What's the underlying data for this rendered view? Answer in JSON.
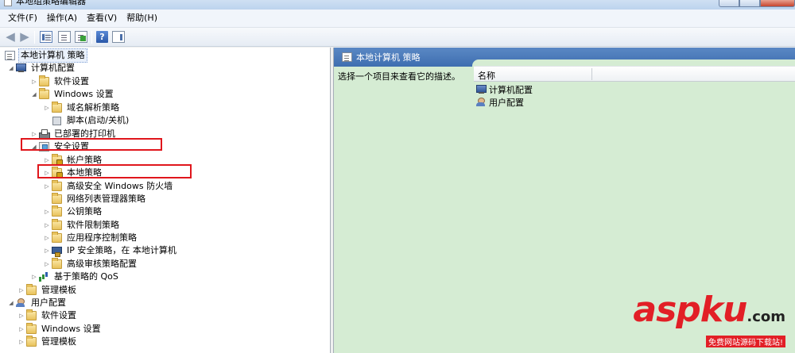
{
  "window": {
    "title": "本地组策略编辑器"
  },
  "menu": [
    {
      "label": "文件(F)"
    },
    {
      "label": "操作(A)"
    },
    {
      "label": "查看(V)"
    },
    {
      "label": "帮助(H)"
    }
  ],
  "toolbar": {
    "back_icon": "back-arrow-icon",
    "forward_icon": "forward-arrow-icon",
    "help_glyph": "?"
  },
  "tree": {
    "root": "本地计算机 策略",
    "computer_config": "计算机配置",
    "software_settings": "软件设置",
    "windows_settings": "Windows 设置",
    "dns_policy": "域名解析策略",
    "scripts": "脚本(启动/关机)",
    "deployed_printers": "已部署的打印机",
    "security_settings": "安全设置",
    "account_policies": "帐户策略",
    "local_policies": "本地策略",
    "firewall": "高级安全 Windows 防火墙",
    "network_list": "网络列表管理器策略",
    "public_key": "公钥策略",
    "software_restriction": "软件限制策略",
    "app_control": "应用程序控制策略",
    "ipsec": "IP 安全策略，在 本地计算机",
    "audit_config": "高级审核策略配置",
    "qos": "基于策略的 QoS",
    "admin_templates": "管理模板",
    "user_config": "用户配置",
    "user_software_settings": "软件设置",
    "user_windows_settings": "Windows 设置",
    "user_admin_templates": "管理模板"
  },
  "right_pane": {
    "header": "本地计算机 策略",
    "description": "选择一个项目来查看它的描述。",
    "column_name": "名称",
    "items": [
      {
        "label": "计算机配置",
        "icon": "computer-icon"
      },
      {
        "label": "用户配置",
        "icon": "user-icon"
      }
    ]
  },
  "watermark": {
    "logo": "aspku",
    "suffix": ".com",
    "tagline": "免费网站源码下载站!"
  },
  "colors": {
    "highlight": "#e0161c",
    "header_blue": "#4a7bbd",
    "right_bg": "#d5ecd3",
    "watermark_red": "#e21f26"
  }
}
